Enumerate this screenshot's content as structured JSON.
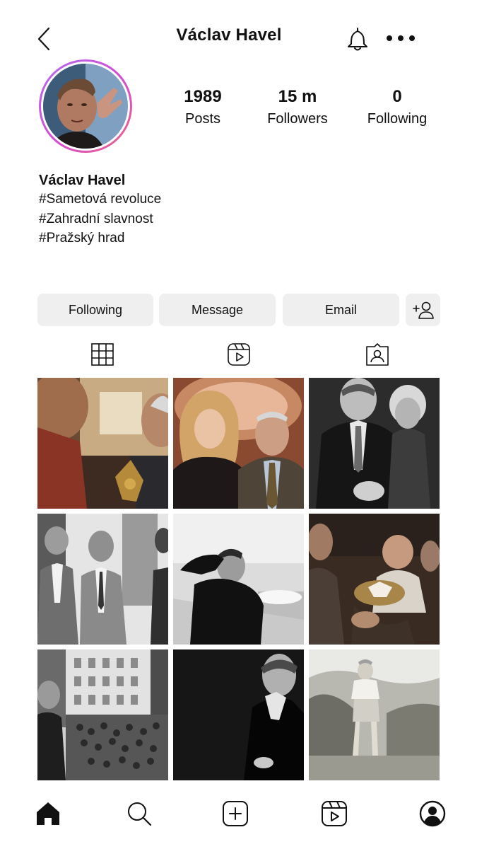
{
  "header": {
    "title": "Václav Havel",
    "back_icon": "chevron-left-icon",
    "notification_icon": "bell-icon",
    "more_icon": "more-horizontal-icon"
  },
  "profile": {
    "avatar_ring_colors": [
      "#b56cf0",
      "#d54ad0",
      "#ec6a82"
    ],
    "stats": [
      {
        "value": "1989",
        "label": "Posts"
      },
      {
        "value": "15 m",
        "label": "Followers"
      },
      {
        "value": "0",
        "label": "Following"
      }
    ],
    "name": "Václav Havel",
    "bio_lines": [
      "#Sametová revoluce",
      "#Zahradní slavnost",
      "#Pražský hrad"
    ]
  },
  "actions": {
    "following": "Following",
    "message": "Message",
    "email": "Email",
    "add_user_icon": "add-user-icon"
  },
  "tabs": [
    "grid-icon",
    "reels-icon",
    "tagged-icon"
  ],
  "bottom_nav": [
    "home-icon",
    "search-icon",
    "create-icon",
    "reels-icon",
    "profile-icon"
  ],
  "colors": {
    "button_bg": "#efefef",
    "text": "#111111"
  }
}
